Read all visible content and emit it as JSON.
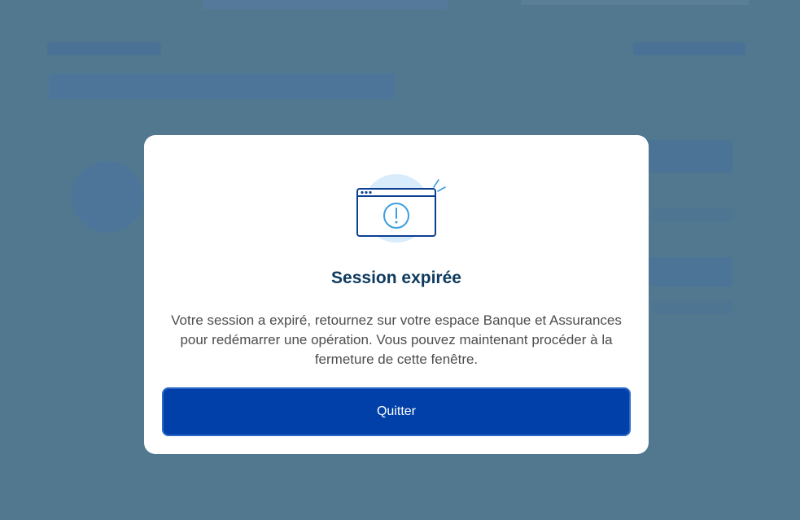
{
  "dialog": {
    "icon": "browser-window-warning-icon",
    "title": "Session expirée",
    "message_line_1": "Votre session a expiré, retournez sur votre espace Banque et Assurances",
    "message_line_2": "pour redémarrer une opération. Vous pouvez maintenant procéder à la",
    "message_line_3": "fermeture de cette fenêtre.",
    "quit_label": "Quitter"
  },
  "colors": {
    "overlay": "#51788f",
    "title": "#0d3a5e",
    "button": "#0040a8",
    "icon_stroke": "#0b3f91",
    "icon_accent": "#3a9fe0",
    "icon_halo": "#d9ecfb"
  }
}
